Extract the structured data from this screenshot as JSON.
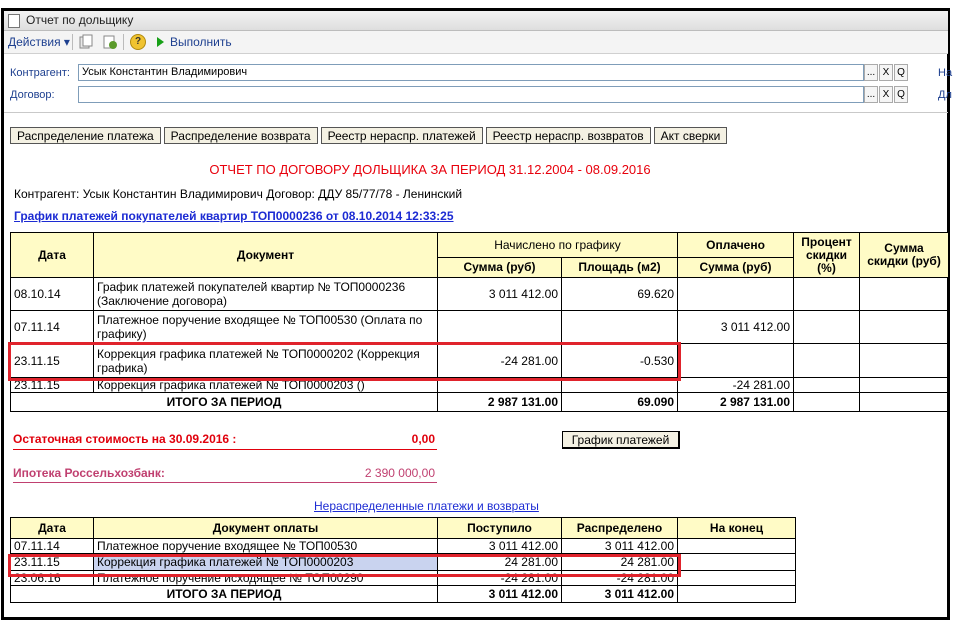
{
  "window": {
    "title": "Отчет по дольщику"
  },
  "toolbar": {
    "actions_label": "Действия ▾",
    "help_label": "?",
    "run_label": "Выполнить"
  },
  "form": {
    "contractor": {
      "label": "Контрагент:",
      "value": "Усык Константин Владимирович"
    },
    "contract": {
      "label": "Договор:",
      "value": ""
    },
    "right_label_1": "На",
    "right_label_2": "Дл",
    "select_btn": "...",
    "clear_btn": "X",
    "search_btn": "Q"
  },
  "tabs": [
    "Распределение платежа",
    "Распределение возврата",
    "Реестр нераспр. платежей",
    "Реестр нераспр. возвратов",
    "Акт сверки"
  ],
  "report": {
    "title": "ОТЧЕТ ПО ДОГОВОРУ ДОЛЬЩИКА ЗА ПЕРИОД 31.12.2004 - 08.09.2016",
    "subtitle": "Контрагент: Усык Константин Владимирович  Договор: ДДУ 85/77/78 - Ленинский",
    "schedule_link": "График платежей покупателей квартир ТОП0000236 от 08.10.2014 12:33:25"
  },
  "table1": {
    "headers": {
      "date": "Дата",
      "document": "Документ",
      "accrued": "Начислено по графику",
      "sum": "Сумма (руб)",
      "area": "Площадь (м2)",
      "paid": "Оплачено",
      "paid_sum": "Сумма (руб)",
      "discount_pct": "Процент скидки (%)",
      "discount_sum": "Сумма скидки (руб)"
    },
    "rows": [
      {
        "date": "08.10.14",
        "doc": "График платежей покупателей квартир №  ТОП0000236 (Заключение договора)",
        "sum": "3 011 412.00",
        "area": "69.620",
        "paid": "",
        "pct": "",
        "disc": ""
      },
      {
        "date": "07.11.14",
        "doc": "Платежное поручение входящее №  ТОП00530 (Оплата по графику)",
        "sum": "",
        "area": "",
        "paid": "3 011 412.00",
        "pct": "",
        "disc": ""
      },
      {
        "date": "23.11.15",
        "doc": "Коррекция графика платежей №  ТОП0000202 (Коррекция графика)",
        "sum": "-24 281.00",
        "area": "-0.530",
        "paid": "",
        "pct": "",
        "disc": ""
      },
      {
        "date": "23.11.15",
        "doc": "Коррекция графика платежей №  ТОП0000203 ()",
        "sum": "",
        "area": "",
        "paid": "-24 281.00",
        "pct": "",
        "disc": ""
      }
    ],
    "total": {
      "label": "ИТОГО ЗА ПЕРИОД",
      "sum": "2 987 131.00",
      "area": "69.090",
      "paid": "2 987 131.00"
    }
  },
  "residual": {
    "label": "Остаточная стоимость на 30.09.2016 :",
    "value": "0,00"
  },
  "mortgage": {
    "label": "Ипотека Россельхозбанк:",
    "value": "2 390 000,00"
  },
  "schedule_button": "График платежей",
  "unallocated_link": "Нераспределенные платежи и возвраты",
  "table2": {
    "headers": {
      "date": "Дата",
      "document": "Документ оплаты",
      "received": "Поступило",
      "allocated": "Распределено",
      "end": "На конец"
    },
    "rows": [
      {
        "date": "07.11.14",
        "doc": "Платежное поручение входящее №  ТОП00530",
        "received": "3 011 412.00",
        "allocated": "3 011 412.00",
        "end": ""
      },
      {
        "date": "23.11.15",
        "doc": "Коррекция графика платежей №  ТОП0000203",
        "received": "24 281.00",
        "allocated": "24 281.00",
        "end": ""
      },
      {
        "date": "23.06.16",
        "doc": "Платежное поручение исходящее №  ТОП00290",
        "received": "-24 281.00",
        "allocated": "-24 281.00",
        "end": ""
      }
    ],
    "total": {
      "label": "ИТОГО ЗА ПЕРИОД",
      "received": "3 011 412.00",
      "allocated": "3 011 412.00"
    }
  },
  "colors": {
    "header_bg": "#fffbc6",
    "title_red": "#e8000c",
    "link_blue": "#1c2bd3",
    "highlight_red": "#e0232c"
  }
}
